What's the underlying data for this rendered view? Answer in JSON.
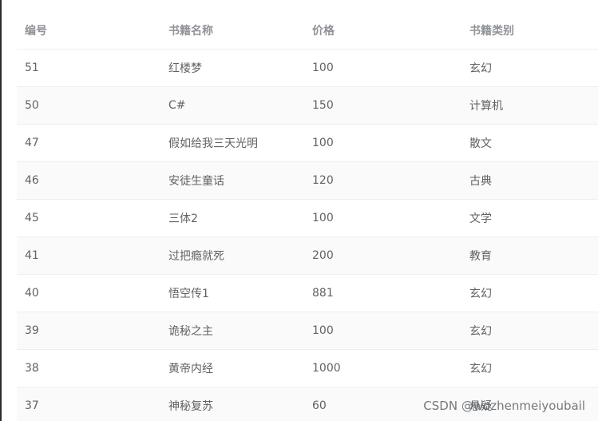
{
  "table": {
    "headers": {
      "id": "编号",
      "name": "书籍名称",
      "price": "价格",
      "category": "书籍类别"
    },
    "rows": [
      {
        "id": "51",
        "name": "红楼梦",
        "price": "100",
        "category": "玄幻"
      },
      {
        "id": "50",
        "name": "C#",
        "price": "150",
        "category": "计算机"
      },
      {
        "id": "47",
        "name": "假如给我三天光明",
        "price": "100",
        "category": "散文"
      },
      {
        "id": "46",
        "name": "安徒生童话",
        "price": "120",
        "category": "古典"
      },
      {
        "id": "45",
        "name": "三体2",
        "price": "100",
        "category": "文学"
      },
      {
        "id": "41",
        "name": "过把瘾就死",
        "price": "200",
        "category": "教育"
      },
      {
        "id": "40",
        "name": "悟空传1",
        "price": "881",
        "category": "玄幻"
      },
      {
        "id": "39",
        "name": "诡秘之主",
        "price": "100",
        "category": "玄幻"
      },
      {
        "id": "38",
        "name": "黄帝内经",
        "price": "1000",
        "category": "玄幻"
      },
      {
        "id": "37",
        "name": "神秘复苏",
        "price": "60",
        "category": "悬疑"
      }
    ]
  },
  "watermark": "CSDN @wozhenmeiyoubail"
}
